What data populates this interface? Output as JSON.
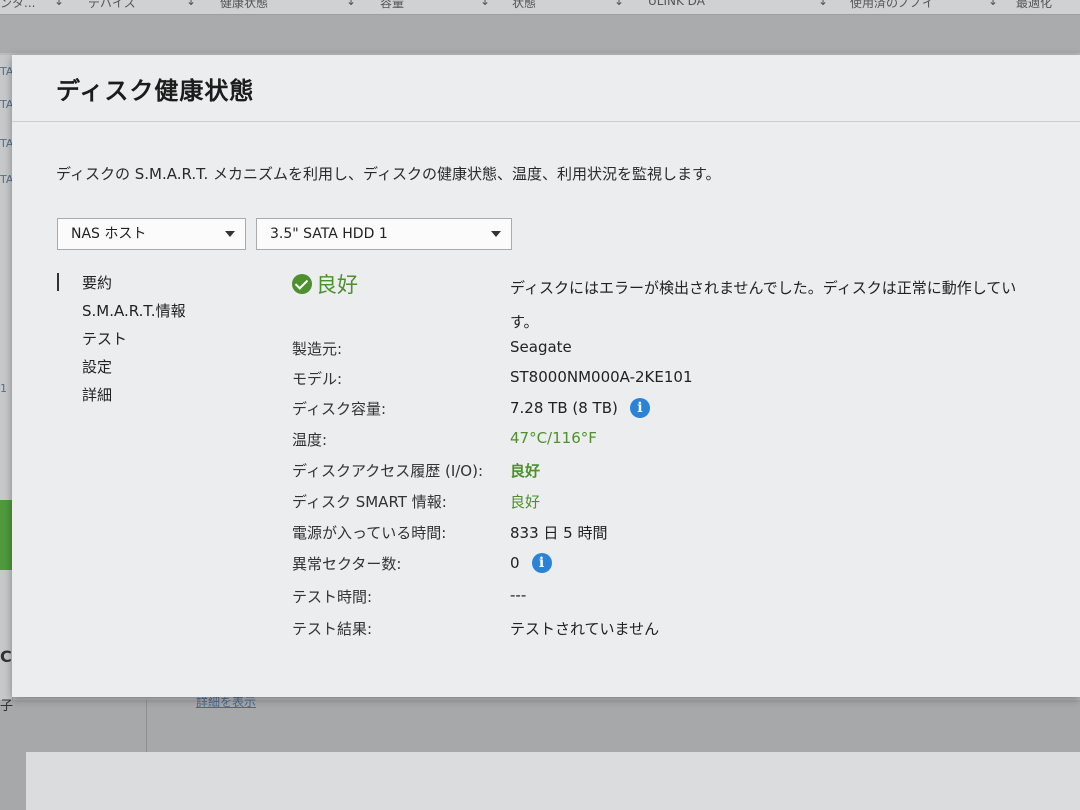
{
  "background": {
    "columns": [
      "ンタ...",
      "↓",
      "デバイス",
      "↓",
      "健康状態",
      "↓",
      "容量",
      "↓",
      "状態",
      "↓",
      "ULINK DA",
      "↓",
      "使用済のノノイ",
      "↓",
      "最適化"
    ],
    "left_labels": [
      "TA",
      "TA",
      "TA",
      "TA",
      "1"
    ],
    "letters": [
      "C",
      "子"
    ],
    "link": "詳細を表示"
  },
  "modal": {
    "title": "ディスク健康状態",
    "description": "ディスクの S.M.A.R.T. メカニズムを利用し、ディスクの健康状態、温度、利用状況を監視します。"
  },
  "selectors": {
    "host": "NAS ホスト",
    "disk": "3.5\" SATA HDD 1"
  },
  "sidenav": [
    {
      "label": "要約",
      "active": true
    },
    {
      "label": "S.M.A.R.T.情報",
      "active": false
    },
    {
      "label": "テスト",
      "active": false
    },
    {
      "label": "設定",
      "active": false
    },
    {
      "label": "詳細",
      "active": false
    }
  ],
  "summary": {
    "status": "良好",
    "message_line1": "ディスクにはエラーが検出されませんでした。ディスクは正常に動作してい",
    "message_line2": "す。"
  },
  "info": {
    "manufacturer_label": "製造元:",
    "manufacturer_value": "Seagate",
    "model_label": "モデル:",
    "model_value": "ST8000NM000A-2KE101",
    "capacity_label": "ディスク容量:",
    "capacity_value": "7.28 TB (8 TB)",
    "temperature_label": "温度:",
    "temperature_value": "47°C/116°F",
    "access_label": "ディスクアクセス履歴 (I/O):",
    "access_value": "良好",
    "smart_label": "ディスク SMART 情報:",
    "smart_value": "良好",
    "power_on_label": "電源が入っている時間:",
    "power_on_value": "833 日 5 時間",
    "bad_sectors_label": "異常セクター数:",
    "bad_sectors_value": "0",
    "test_time_label": "テスト時間:",
    "test_time_value": "---",
    "test_result_label": "テスト結果:",
    "test_result_value": "テストされていません"
  },
  "icons": {
    "info": "i"
  },
  "colors": {
    "good": "#4e8f2e",
    "info_icon": "#2b83d7"
  }
}
